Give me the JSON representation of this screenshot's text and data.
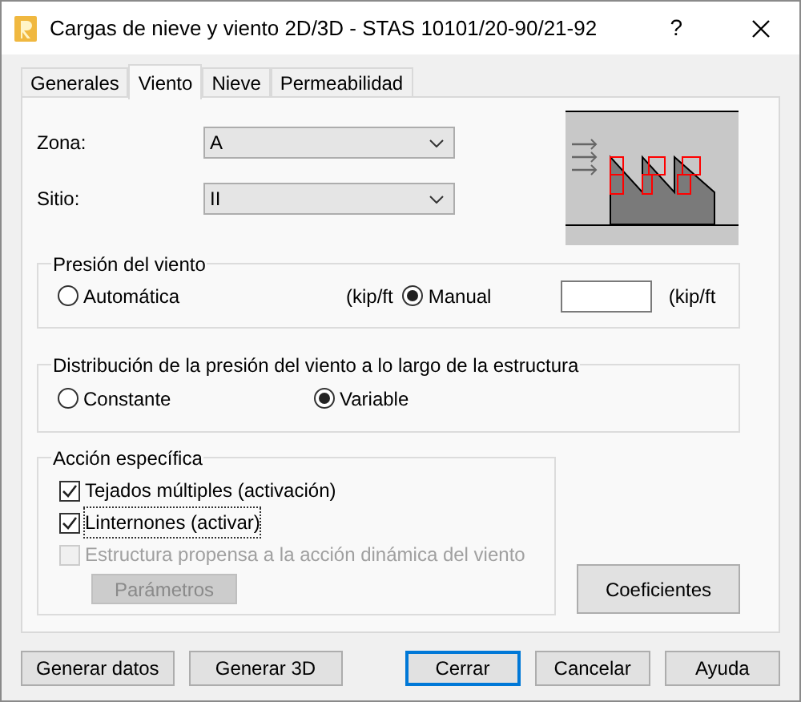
{
  "window": {
    "title": "Cargas de nieve y viento 2D/3D - STAS 10101/20-90/21-92",
    "help": "?"
  },
  "tabs": [
    {
      "label": "Generales",
      "selected": false
    },
    {
      "label": "Viento",
      "selected": true
    },
    {
      "label": "Nieve",
      "selected": false
    },
    {
      "label": "Permeabilidad",
      "selected": false
    }
  ],
  "fields": [
    {
      "label": "Zona:",
      "value": "A"
    },
    {
      "label": "Sitio:",
      "value": "II"
    }
  ],
  "presion": {
    "title": "Presión del viento",
    "unit_1": "(kip/ft",
    "unit_2": "(kip/ft",
    "options": [
      {
        "label": "Automática",
        "selected": false
      },
      {
        "label": "Manual",
        "selected": true
      }
    ]
  },
  "distribucion": {
    "title": "Distribución de la presión del viento a lo largo de la estructura",
    "options": [
      {
        "label": "Constante",
        "selected": false
      },
      {
        "label": "Variable",
        "selected": true
      }
    ]
  },
  "accion": {
    "title": "Acción específica",
    "checks": [
      {
        "label": "Tejados múltiples (activación)",
        "checked": true,
        "disabled": false,
        "focused": false
      },
      {
        "label": "Linternones (activar)",
        "checked": true,
        "disabled": false,
        "focused": true
      },
      {
        "label": "Estructura propensa a la acción dinámica del viento",
        "checked": false,
        "disabled": true,
        "focused": false
      }
    ],
    "parametros": {
      "label": "Parámetros",
      "disabled": true
    }
  },
  "coeficientes": {
    "label": "Coeficientes"
  },
  "buttons": [
    {
      "label": "Generar datos",
      "default": false
    },
    {
      "label": "Generar 3D",
      "default": false
    },
    {
      "label": "Cerrar",
      "default": true
    },
    {
      "label": "Cancelar",
      "default": false
    },
    {
      "label": "Ayuda",
      "default": false
    }
  ]
}
